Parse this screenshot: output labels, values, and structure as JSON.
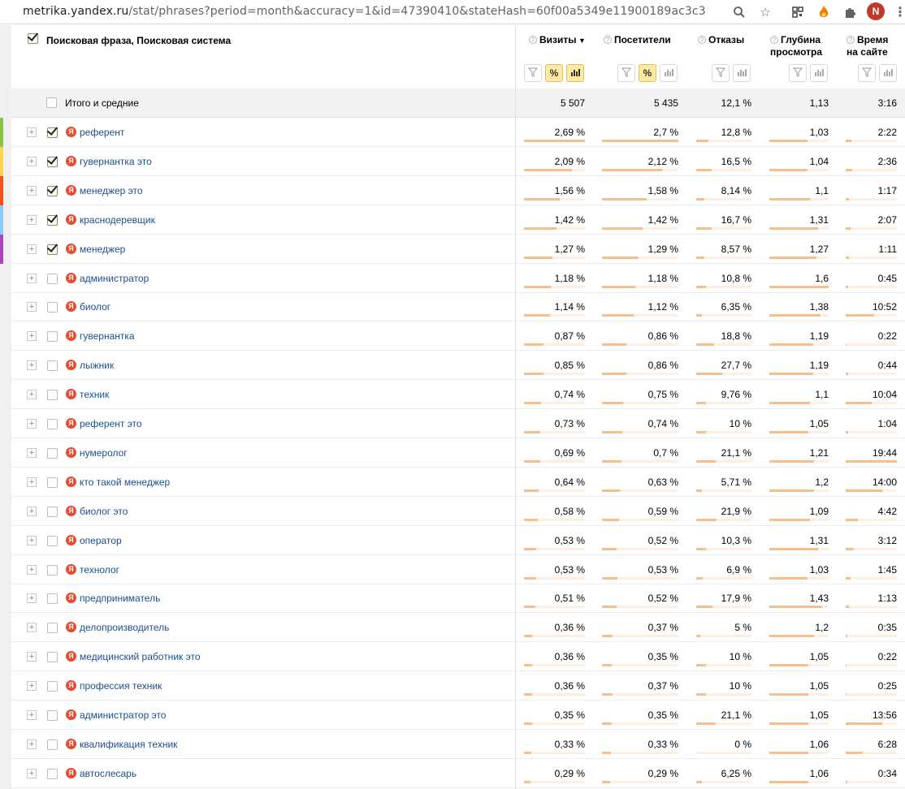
{
  "browser": {
    "url_host": "metrika.yandex.ru",
    "url_rest": "/stat/phrases?period=month&accuracy=1&id=47390410&stateHash=60f00a5349e11900189ac3c3",
    "avatar_letter": "N"
  },
  "table": {
    "dimension_title": "Поисковая фраза, Поисковая система",
    "columns": [
      {
        "key": "visits",
        "title1": "Визиты",
        "title2": "",
        "sorted": "▼"
      },
      {
        "key": "visitors",
        "title1": "Посетители",
        "title2": ""
      },
      {
        "key": "bounce",
        "title1": "Отказы",
        "title2": ""
      },
      {
        "key": "depth",
        "title1": "Глубина",
        "title2": "просмотра"
      },
      {
        "key": "time",
        "title1": "Время",
        "title2": "на сайте"
      }
    ],
    "totals": {
      "label": "Итого и средние",
      "visits": "5 507",
      "visitors": "5 435",
      "bounce": "12,1 %",
      "depth": "1,13",
      "time": "3:16"
    },
    "rows": [
      {
        "phrase": "референт",
        "checked": true,
        "color": "#8bc34a",
        "visits": "2,69 %",
        "visitors": "2,7 %",
        "bounce": "12,8 %",
        "depth": "1,03",
        "time": "2:22",
        "bars": {
          "visits": 1.0,
          "visitors": 1.0,
          "bounce": 0.22,
          "depth": 0.64,
          "time": 0.11
        }
      },
      {
        "phrase": "гувернантка это",
        "checked": true,
        "color": "#ffd54f",
        "visits": "2,09 %",
        "visitors": "2,12 %",
        "bounce": "16,5 %",
        "depth": "1,04",
        "time": "2:36",
        "bars": {
          "visits": 0.78,
          "visitors": 0.79,
          "bounce": 0.28,
          "depth": 0.65,
          "time": 0.12
        }
      },
      {
        "phrase": "менеджер это",
        "checked": true,
        "color": "#f4511e",
        "visits": "1,56 %",
        "visitors": "1,58 %",
        "bounce": "8,14 %",
        "depth": "1,1",
        "time": "1:17",
        "bars": {
          "visits": 0.58,
          "visitors": 0.59,
          "bounce": 0.14,
          "depth": 0.69,
          "time": 0.06
        }
      },
      {
        "phrase": "краснодеревщик",
        "checked": true,
        "color": "#90caf9",
        "visits": "1,42 %",
        "visitors": "1,42 %",
        "bounce": "16,7 %",
        "depth": "1,31",
        "time": "2:07",
        "bars": {
          "visits": 0.53,
          "visitors": 0.53,
          "bounce": 0.28,
          "depth": 0.82,
          "time": 0.1
        }
      },
      {
        "phrase": "менеджер",
        "checked": true,
        "color": "#ab47bc",
        "visits": "1,27 %",
        "visitors": "1,29 %",
        "bounce": "8,57 %",
        "depth": "1,27",
        "time": "1:11",
        "bars": {
          "visits": 0.47,
          "visitors": 0.48,
          "bounce": 0.14,
          "depth": 0.79,
          "time": 0.06
        }
      },
      {
        "phrase": "администратор",
        "checked": false,
        "visits": "1,18 %",
        "visitors": "1,18 %",
        "bounce": "10,8 %",
        "depth": "1,6",
        "time": "0:45",
        "bars": {
          "visits": 0.44,
          "visitors": 0.44,
          "bounce": 0.18,
          "depth": 1.0,
          "time": 0.04
        }
      },
      {
        "phrase": "биолог",
        "checked": false,
        "visits": "1,14 %",
        "visitors": "1,12 %",
        "bounce": "6,35 %",
        "depth": "1,38",
        "time": "10:52",
        "bars": {
          "visits": 0.42,
          "visitors": 0.41,
          "bounce": 0.11,
          "depth": 0.86,
          "time": 0.55
        }
      },
      {
        "phrase": "гувернантка",
        "checked": false,
        "visits": "0,87 %",
        "visitors": "0,86 %",
        "bounce": "18,8 %",
        "depth": "1,19",
        "time": "0:22",
        "bars": {
          "visits": 0.32,
          "visitors": 0.32,
          "bounce": 0.32,
          "depth": 0.74,
          "time": 0.02
        }
      },
      {
        "phrase": "лыжник",
        "checked": false,
        "visits": "0,85 %",
        "visitors": "0,86 %",
        "bounce": "27,7 %",
        "depth": "1,19",
        "time": "0:44",
        "bars": {
          "visits": 0.32,
          "visitors": 0.32,
          "bounce": 0.47,
          "depth": 0.74,
          "time": 0.04
        }
      },
      {
        "phrase": "техник",
        "checked": false,
        "visits": "0,74 %",
        "visitors": "0,75 %",
        "bounce": "9,76 %",
        "depth": "1,1",
        "time": "10:04",
        "bars": {
          "visits": 0.28,
          "visitors": 0.28,
          "bounce": 0.17,
          "depth": 0.69,
          "time": 0.51
        }
      },
      {
        "phrase": "референт это",
        "checked": false,
        "visits": "0,73 %",
        "visitors": "0,74 %",
        "bounce": "10 %",
        "depth": "1,05",
        "time": "1:04",
        "bars": {
          "visits": 0.27,
          "visitors": 0.27,
          "bounce": 0.17,
          "depth": 0.66,
          "time": 0.05
        }
      },
      {
        "phrase": "нумеролог",
        "checked": false,
        "visits": "0,69 %",
        "visitors": "0,7 %",
        "bounce": "21,1 %",
        "depth": "1,21",
        "time": "19:44",
        "bars": {
          "visits": 0.26,
          "visitors": 0.26,
          "bounce": 0.36,
          "depth": 0.76,
          "time": 1.0
        }
      },
      {
        "phrase": "кто такой менеджер",
        "checked": false,
        "visits": "0,64 %",
        "visitors": "0,63 %",
        "bounce": "5,71 %",
        "depth": "1,2",
        "time": "14:00",
        "bars": {
          "visits": 0.24,
          "visitors": 0.23,
          "bounce": 0.1,
          "depth": 0.75,
          "time": 0.71
        }
      },
      {
        "phrase": "биолог это",
        "checked": false,
        "visits": "0,58 %",
        "visitors": "0,59 %",
        "bounce": "21,9 %",
        "depth": "1,09",
        "time": "4:42",
        "bars": {
          "visits": 0.22,
          "visitors": 0.22,
          "bounce": 0.37,
          "depth": 0.68,
          "time": 0.24
        }
      },
      {
        "phrase": "оператор",
        "checked": false,
        "visits": "0,53 %",
        "visitors": "0,52 %",
        "bounce": "10,3 %",
        "depth": "1,31",
        "time": "3:12",
        "bars": {
          "visits": 0.2,
          "visitors": 0.19,
          "bounce": 0.18,
          "depth": 0.82,
          "time": 0.16
        }
      },
      {
        "phrase": "технолог",
        "checked": false,
        "visits": "0,53 %",
        "visitors": "0,53 %",
        "bounce": "6,9 %",
        "depth": "1,03",
        "time": "1:45",
        "bars": {
          "visits": 0.2,
          "visitors": 0.2,
          "bounce": 0.12,
          "depth": 0.64,
          "time": 0.09
        }
      },
      {
        "phrase": "предприниматель",
        "checked": false,
        "visits": "0,51 %",
        "visitors": "0,52 %",
        "bounce": "17,9 %",
        "depth": "1,43",
        "time": "1:13",
        "bars": {
          "visits": 0.19,
          "visitors": 0.19,
          "bounce": 0.3,
          "depth": 0.89,
          "time": 0.06
        }
      },
      {
        "phrase": "делопроизводитель",
        "checked": false,
        "visits": "0,36 %",
        "visitors": "0,37 %",
        "bounce": "5 %",
        "depth": "1,2",
        "time": "0:35",
        "bars": {
          "visits": 0.13,
          "visitors": 0.14,
          "bounce": 0.08,
          "depth": 0.75,
          "time": 0.03
        }
      },
      {
        "phrase": "медицинский работник это",
        "checked": false,
        "visits": "0,36 %",
        "visitors": "0,35 %",
        "bounce": "10 %",
        "depth": "1,05",
        "time": "0:22",
        "bars": {
          "visits": 0.13,
          "visitors": 0.13,
          "bounce": 0.17,
          "depth": 0.66,
          "time": 0.02
        }
      },
      {
        "phrase": "профессия техник",
        "checked": false,
        "visits": "0,36 %",
        "visitors": "0,37 %",
        "bounce": "10 %",
        "depth": "1,05",
        "time": "0:25",
        "bars": {
          "visits": 0.13,
          "visitors": 0.14,
          "bounce": 0.17,
          "depth": 0.66,
          "time": 0.02
        }
      },
      {
        "phrase": "администратор это",
        "checked": false,
        "visits": "0,35 %",
        "visitors": "0,35 %",
        "bounce": "21,1 %",
        "depth": "1,05",
        "time": "13:56",
        "bars": {
          "visits": 0.13,
          "visitors": 0.13,
          "bounce": 0.36,
          "depth": 0.66,
          "time": 0.71
        }
      },
      {
        "phrase": "квалификация техник",
        "checked": false,
        "visits": "0,33 %",
        "visitors": "0,33 %",
        "bounce": "0 %",
        "depth": "1,06",
        "time": "6:28",
        "bars": {
          "visits": 0.12,
          "visitors": 0.12,
          "bounce": 0.0,
          "depth": 0.66,
          "time": 0.33
        }
      },
      {
        "phrase": "автослесарь",
        "checked": false,
        "visits": "0,29 %",
        "visitors": "0,29 %",
        "bounce": "6,25 %",
        "depth": "1,06",
        "time": "0:34",
        "bars": {
          "visits": 0.11,
          "visitors": 0.11,
          "bounce": 0.11,
          "depth": 0.66,
          "time": 0.03
        }
      }
    ]
  },
  "icons": {
    "filter": "funnel-icon",
    "percent": "percent-icon",
    "chart": "bar-chart-icon",
    "yandex": "yandex-logo-icon"
  },
  "tool_labels": {
    "percent": "%"
  }
}
